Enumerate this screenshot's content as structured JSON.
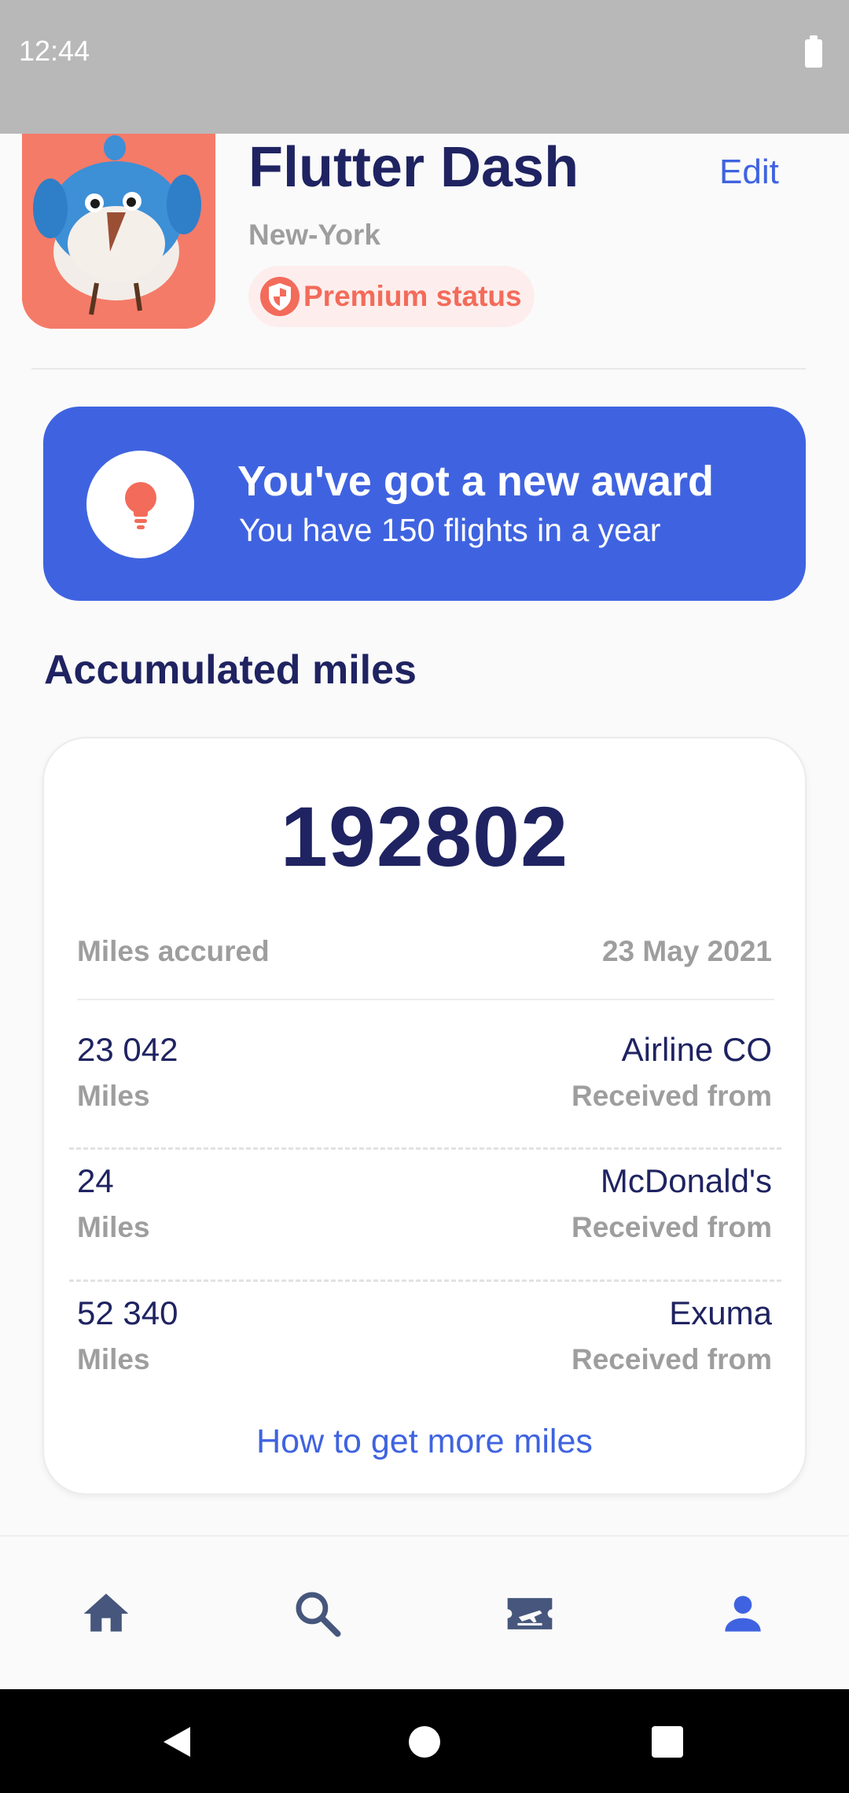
{
  "status_bar": {
    "time": "12:44",
    "battery_icon": "battery-full-icon"
  },
  "profile": {
    "name": "Flutter Dash",
    "city": "New-York",
    "edit_label": "Edit",
    "badge_label": "Premium status",
    "badge_icon": "shield-icon",
    "avatar_icon": "dash-bird-avatar"
  },
  "award": {
    "title": "You've got a new award",
    "subtitle": "You have 150 flights in a year",
    "icon": "lightbulb-icon"
  },
  "miles": {
    "section_title": "Accumulated miles",
    "total": "192802",
    "accrued_label": "Miles accured",
    "date": "23 May 2021",
    "transactions": [
      {
        "amount": "23 042",
        "unit": "Miles",
        "source": "Airline CO",
        "source_label": "Received from"
      },
      {
        "amount": "24",
        "unit": "Miles",
        "source": "McDonald's",
        "source_label": "Received from"
      },
      {
        "amount": "52 340",
        "unit": "Miles",
        "source": "Exuma",
        "source_label": "Received from"
      }
    ],
    "more_link": "How to get more miles"
  },
  "bottom_nav": {
    "items": [
      {
        "icon": "home-icon",
        "active": false
      },
      {
        "icon": "search-icon",
        "active": false
      },
      {
        "icon": "flight-ticket-icon",
        "active": false
      },
      {
        "icon": "person-icon",
        "active": true
      }
    ]
  },
  "colors": {
    "accent": "#3f63e0",
    "navy": "#1f2361",
    "coral": "#f36b5a",
    "muted": "#9e9e9e",
    "nav_inactive": "#46567c"
  }
}
